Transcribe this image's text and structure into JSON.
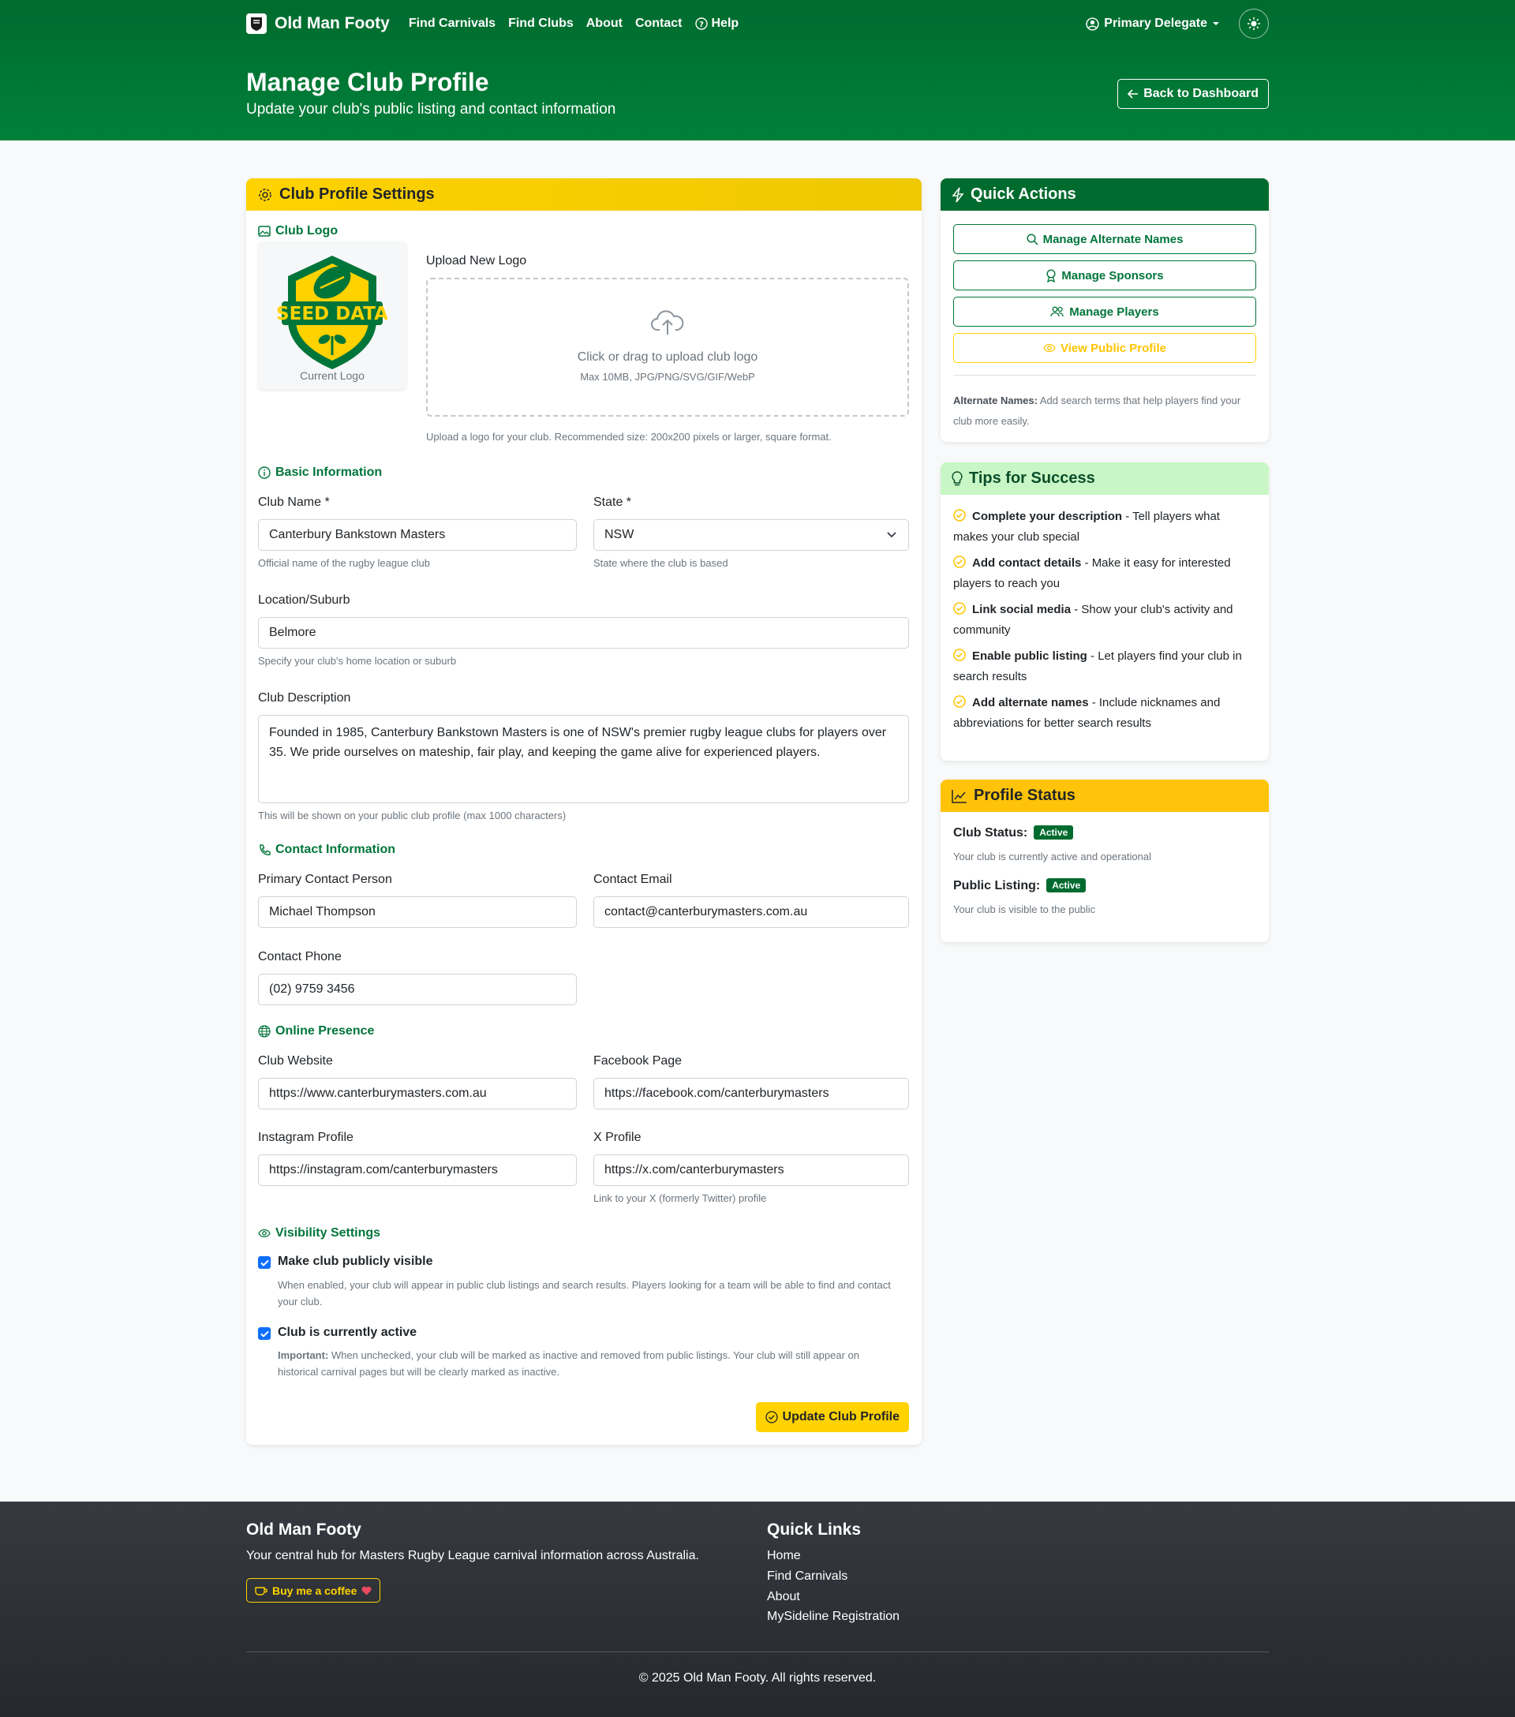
{
  "nav": {
    "brand": "Old Man Footy",
    "links": [
      "Find Carnivals",
      "Find Clubs",
      "About",
      "Contact",
      "Help"
    ],
    "user": "Primary Delegate"
  },
  "hero": {
    "title": "Manage Club Profile",
    "subtitle": "Update your club's public listing and contact information",
    "back_label": "Back to Dashboard"
  },
  "form": {
    "card_title": "Club Profile Settings",
    "logo": {
      "section": "Club Logo",
      "current_caption": "Current Logo",
      "logo_text": "SEED DATA",
      "upload_label": "Upload New Logo",
      "dropzone_main": "Click or drag to upload club logo",
      "dropzone_sub": "Max 10MB, JPG/PNG/SVG/GIF/WebP",
      "help": "Upload a logo for your club. Recommended size: 200x200 pixels or larger, square format."
    },
    "basic": {
      "section": "Basic Information",
      "club_name_label": "Club Name *",
      "club_name_value": "Canterbury Bankstown Masters",
      "club_name_help": "Official name of the rugby league club",
      "state_label": "State *",
      "state_value": "NSW",
      "state_help": "State where the club is based",
      "location_label": "Location/Suburb",
      "location_value": "Belmore",
      "location_help": "Specify your club's home location or suburb",
      "description_label": "Club Description",
      "description_value": "Founded in 1985, Canterbury Bankstown Masters is one of NSW's premier rugby league clubs for players over 35. We pride ourselves on mateship, fair play, and keeping the game alive for experienced players.",
      "description_help": "This will be shown on your public club profile (max 1000 characters)"
    },
    "contact": {
      "section": "Contact Information",
      "person_label": "Primary Contact Person",
      "person_value": "Michael Thompson",
      "email_label": "Contact Email",
      "email_value": "contact@canterburymasters.com.au",
      "phone_label": "Contact Phone",
      "phone_value": "(02) 9759 3456"
    },
    "online": {
      "section": "Online Presence",
      "website_label": "Club Website",
      "website_value": "https://www.canterburymasters.com.au",
      "facebook_label": "Facebook Page",
      "facebook_value": "https://facebook.com/canterburymasters",
      "instagram_label": "Instagram Profile",
      "instagram_value": "https://instagram.com/canterburymasters",
      "x_label": "X Profile",
      "x_value": "https://x.com/canterburymasters",
      "x_help": "Link to your X (formerly Twitter) profile"
    },
    "visibility": {
      "section": "Visibility Settings",
      "public_label": "Make club publicly visible",
      "public_help": "When enabled, your club will appear in public club listings and search results. Players looking for a team will be able to find and contact your club.",
      "active_label": "Club is currently active",
      "active_help_strong": "Important:",
      "active_help": " When unchecked, your club will be marked as inactive and removed from public listings. Your club will still appear on historical carnival pages but will be clearly marked as inactive."
    },
    "submit_label": "Update Club Profile"
  },
  "quick_actions": {
    "title": "Quick Actions",
    "buttons": [
      "Manage Alternate Names",
      "Manage Sponsors",
      "Manage Players",
      "View Public Profile"
    ],
    "note_strong": "Alternate Names:",
    "note": " Add search terms that help players find your club more easily."
  },
  "tips": {
    "title": "Tips for Success",
    "items": [
      {
        "strong": "Complete your description",
        "text": " - Tell players what makes your club special"
      },
      {
        "strong": "Add contact details",
        "text": " - Make it easy for interested players to reach you"
      },
      {
        "strong": "Link social media",
        "text": " - Show your club's activity and community"
      },
      {
        "strong": "Enable public listing",
        "text": " - Let players find your club in search results"
      },
      {
        "strong": "Add alternate names",
        "text": " - Include nicknames and abbreviations for better search results"
      }
    ]
  },
  "status": {
    "title": "Profile Status",
    "club_status_label": "Club Status:",
    "club_status_badge": "Active",
    "club_status_help": "Your club is currently active and operational",
    "listing_label": "Public Listing:",
    "listing_badge": "Active",
    "listing_help": "Your club is visible to the public"
  },
  "footer": {
    "title": "Old Man Footy",
    "tagline": "Your central hub for Masters Rugby League carnival information across Australia.",
    "coffee_label": "Buy me a coffee",
    "links_title": "Quick Links",
    "links": [
      "Home",
      "Find Carnivals",
      "About",
      "MySideline Registration"
    ],
    "copyright": "© 2025 Old Man Footy. All rights reserved."
  },
  "colors": {
    "brand_green": "#006b2e",
    "accent_yellow": "#ffd200",
    "link_green": "#00753a"
  }
}
